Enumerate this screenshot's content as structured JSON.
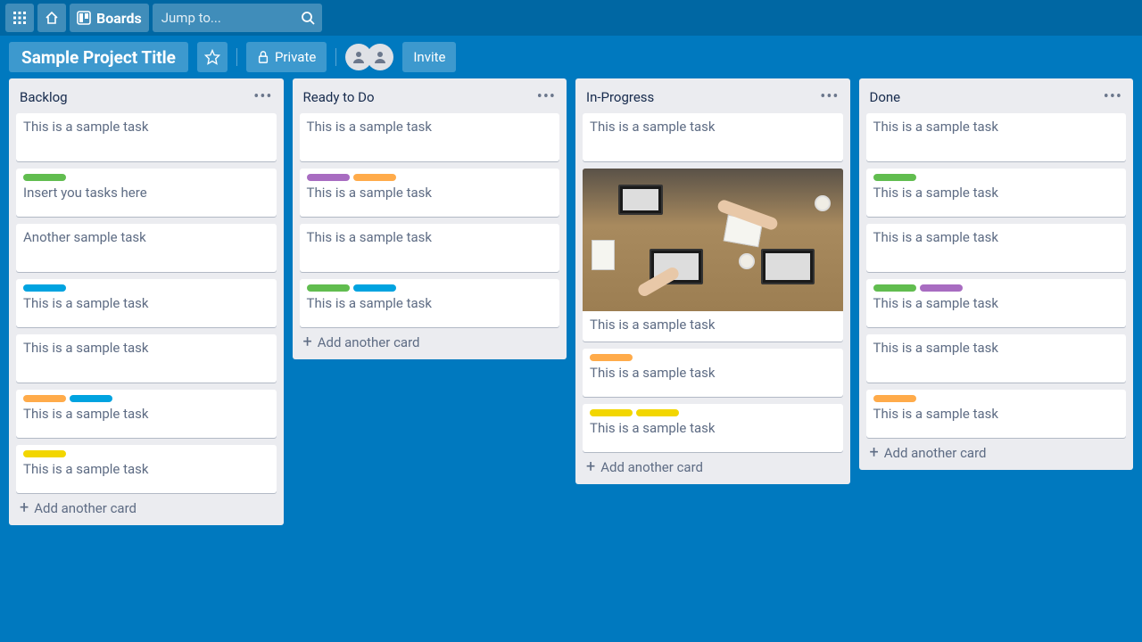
{
  "topbar": {
    "boards_label": "Boards",
    "search_placeholder": "Jump to..."
  },
  "header": {
    "board_title": "Sample Project Title",
    "visibility": "Private",
    "invite_label": "Invite"
  },
  "lists": [
    {
      "title": "Backlog",
      "cards": [
        {
          "labels": [],
          "text": "This is a sample task"
        },
        {
          "labels": [
            "green"
          ],
          "text": "Insert you tasks here"
        },
        {
          "labels": [],
          "text": "Another sample task"
        },
        {
          "labels": [
            "blue"
          ],
          "text": "This is a sample task"
        },
        {
          "labels": [],
          "text": "This is a sample task"
        },
        {
          "labels": [
            "orange",
            "blue"
          ],
          "text": "This is a sample task"
        },
        {
          "labels": [
            "yellow"
          ],
          "text": "This is a sample task"
        }
      ],
      "add_label": "Add another card"
    },
    {
      "title": "Ready to Do",
      "cards": [
        {
          "labels": [],
          "text": "This is a sample task"
        },
        {
          "labels": [
            "purple",
            "orange"
          ],
          "text": "This is a sample task"
        },
        {
          "labels": [],
          "text": "This is a sample task"
        },
        {
          "labels": [
            "green",
            "blue"
          ],
          "text": "This is a sample task"
        }
      ],
      "add_label": "Add another card"
    },
    {
      "title": "In-Progress",
      "cards": [
        {
          "labels": [],
          "text": "This is a sample task"
        },
        {
          "labels": [],
          "text": "This is a sample task",
          "cover": true
        },
        {
          "labels": [
            "orange"
          ],
          "text": "This is a sample task"
        },
        {
          "labels": [
            "yellow",
            "yellow"
          ],
          "text": "This is a sample task"
        }
      ],
      "add_label": "Add another card"
    },
    {
      "title": "Done",
      "cards": [
        {
          "labels": [],
          "text": "This is a sample task"
        },
        {
          "labels": [
            "green"
          ],
          "text": "This is a sample task"
        },
        {
          "labels": [],
          "text": "This is a sample task"
        },
        {
          "labels": [
            "green",
            "purple"
          ],
          "text": "This is a sample task"
        },
        {
          "labels": [],
          "text": "This is a sample task"
        },
        {
          "labels": [
            "orange"
          ],
          "text": "This is a sample task"
        }
      ],
      "add_label": "Add another card"
    }
  ]
}
